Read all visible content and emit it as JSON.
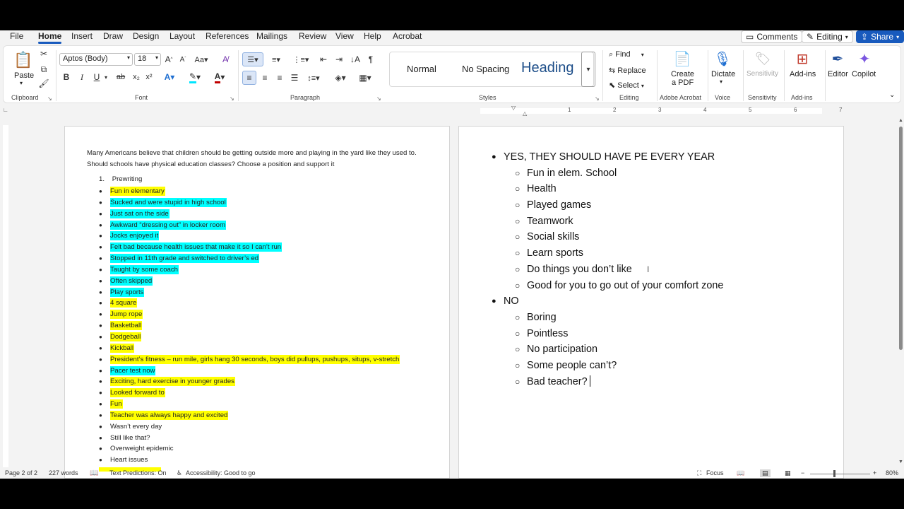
{
  "menu": {
    "tabs": [
      "File",
      "Home",
      "Insert",
      "Draw",
      "Design",
      "Layout",
      "References",
      "Mailings",
      "Review",
      "View",
      "Help",
      "Acrobat"
    ],
    "active": "Home",
    "comments": "Comments",
    "editing": "Editing",
    "share": "Share"
  },
  "ribbon": {
    "clipboard": {
      "paste": "Paste",
      "label": "Clipboard"
    },
    "font": {
      "name": "Aptos (Body)",
      "size": "18",
      "label": "Font"
    },
    "paragraph": {
      "label": "Paragraph"
    },
    "styles": {
      "items": [
        "Normal",
        "No Spacing",
        "Heading"
      ],
      "label": "Styles"
    },
    "editing": {
      "find": "Find",
      "replace": "Replace",
      "select": "Select",
      "label": "Editing"
    },
    "acrobat": {
      "create_pdf_line1": "Create",
      "create_pdf_line2": "a PDF",
      "label": "Adobe Acrobat"
    },
    "voice": {
      "dictate": "Dictate",
      "label": "Voice"
    },
    "sensitivity": {
      "button": "Sensitivity",
      "label": "Sensitivity"
    },
    "addins": {
      "button": "Add-ins",
      "label": "Add-ins"
    },
    "editor": "Editor",
    "copilot": "Copilot"
  },
  "ruler": {
    "numbers": [
      "1",
      "2",
      "3",
      "4",
      "5",
      "6",
      "7"
    ]
  },
  "page1": {
    "intro": "Many Americans believe that children should be getting outside more and playing in the yard like they used to. Should schools have physical education classes? Choose a position and support it",
    "numbered": "Prewriting",
    "items": [
      {
        "text": "Fun in elementary",
        "hl": "y"
      },
      {
        "text": "Sucked and were stupid in high school",
        "hl": "c"
      },
      {
        "text": "Just sat on the side",
        "hl": "c"
      },
      {
        "text": "Awkward “dressing out” in locker room",
        "hl": "c"
      },
      {
        "text": "Jocks enjoyed it",
        "hl": "c"
      },
      {
        "text": "Felt bad because health issues that make it so I can’t run",
        "hl": "c"
      },
      {
        "text": "Stopped in 11th grade and switched to driver’s ed",
        "hl": "c"
      },
      {
        "text": "Taught by some coach",
        "hl": "c"
      },
      {
        "text": "Often skipped",
        "hl": "c"
      },
      {
        "text": "Play sports",
        "hl": "c"
      },
      {
        "text": "4 square",
        "hl": "y"
      },
      {
        "text": "Jump rope",
        "hl": "y"
      },
      {
        "text": "Basketball",
        "hl": "y"
      },
      {
        "text": "Dodgeball",
        "hl": "y"
      },
      {
        "text": "Kickball",
        "hl": "y"
      },
      {
        "text": "President’s fitness – run mile, girls hang 30 seconds, boys did pullups, pushups, situps, v-stretch",
        "hl": "y"
      },
      {
        "text": "Pacer test now",
        "hl": "c"
      },
      {
        "text": "Exciting, hard exercise in younger grades",
        "hl": "y"
      },
      {
        "text": "Looked forward to",
        "hl": "y"
      },
      {
        "text": "Fun",
        "hl": "y"
      },
      {
        "text": "Teacher was always happy and excited",
        "hl": "y"
      },
      {
        "text": "Wasn’t every day",
        "hl": ""
      },
      {
        "text": "Still like that?",
        "hl": ""
      },
      {
        "text": "Overweight epidemic",
        "hl": ""
      },
      {
        "text": "Heart issues",
        "hl": ""
      }
    ]
  },
  "page2": {
    "sections": [
      {
        "heading": "YES, THEY SHOULD HAVE PE EVERY YEAR",
        "items": [
          "Fun in elem. School",
          "Health",
          "Played games",
          "Teamwork",
          "Social skills",
          "Learn sports",
          "Do things you don’t like",
          "Good for you to go out of your comfort zone"
        ]
      },
      {
        "heading": "NO",
        "items": [
          "Boring",
          "Pointless",
          "No participation",
          "Some people can’t?",
          "Bad teacher?"
        ]
      }
    ]
  },
  "status": {
    "page": "Page 2 of 2",
    "words": "227 words",
    "predictions": "Text Predictions: On",
    "accessibility": "Accessibility: Good to go",
    "focus": "Focus",
    "zoom": "80%"
  },
  "colors": {
    "highlight_yellow": "#ffff00",
    "highlight_cyan": "#00ffff",
    "accent": "#185abd"
  }
}
